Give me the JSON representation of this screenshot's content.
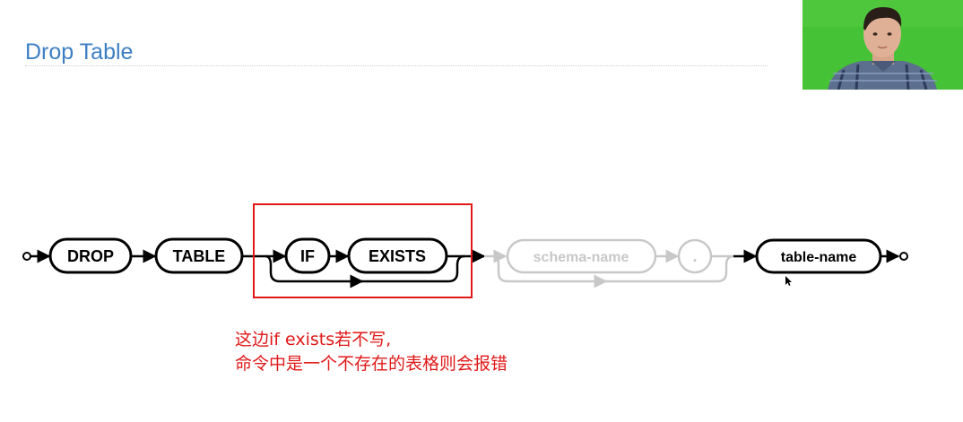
{
  "slide": {
    "title": "Drop Table"
  },
  "diagram": {
    "keywords": {
      "drop": "DROP",
      "table": "TABLE",
      "if": "IF",
      "exists": "EXISTS",
      "schema_name": "schema-name",
      "dot": ".",
      "table_name": "table-name"
    },
    "highlight_color": "#e01818",
    "dimmed_color": "#c8c8c8"
  },
  "annotation": {
    "line1": "这边if exists若不写,",
    "line2": "命令中是一个不存在的表格则会报错",
    "color": "#e01818"
  },
  "webcam": {
    "background": "#3fbf2f"
  }
}
